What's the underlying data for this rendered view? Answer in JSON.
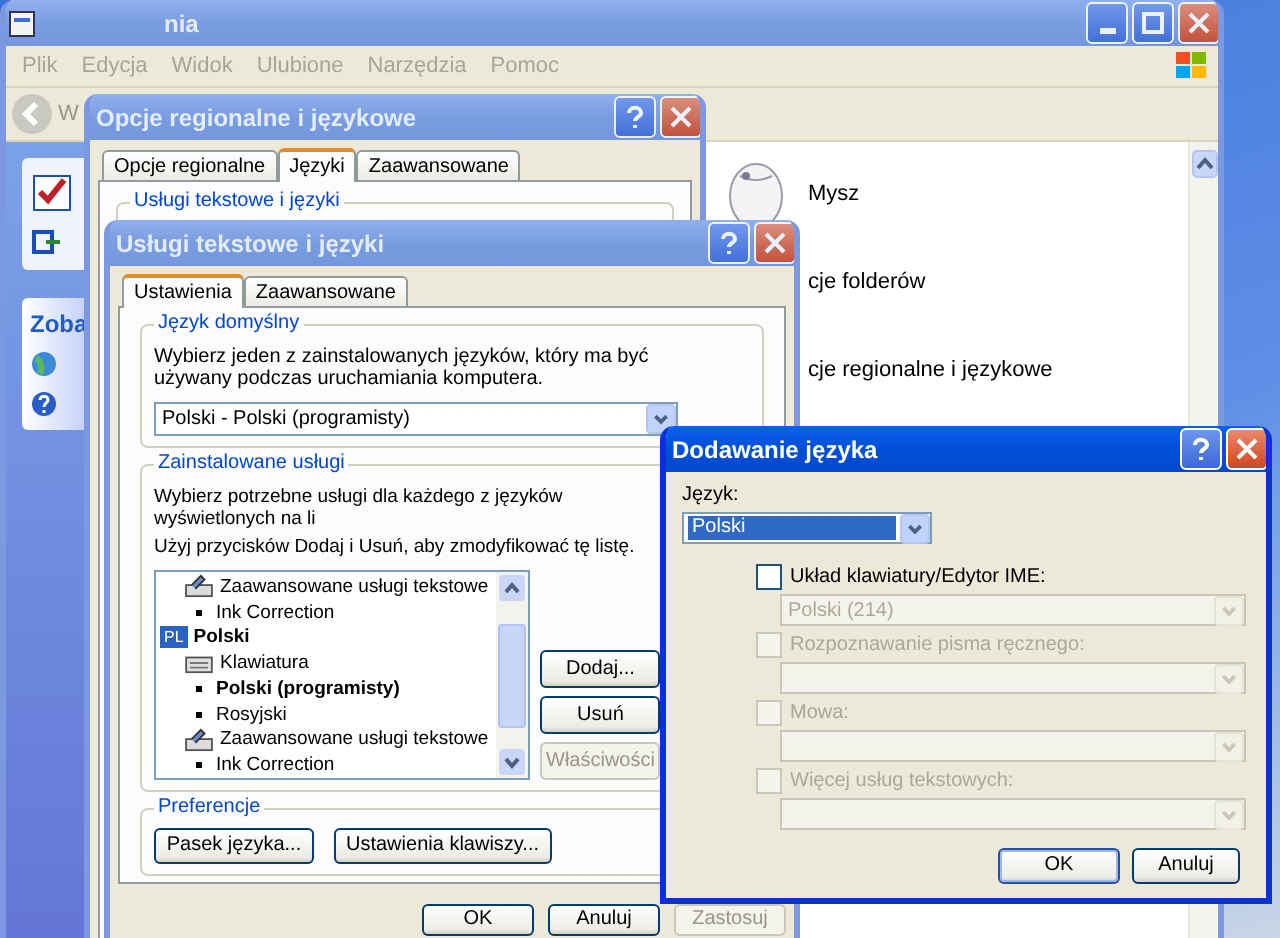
{
  "explorer": {
    "title": "nia",
    "active": false,
    "menu": [
      "Plik",
      "Edycja",
      "Widok",
      "Ulubione",
      "Narzędzia",
      "Pomoc"
    ],
    "back_label": "W",
    "task_pane_heading": "Zoba",
    "items": [
      {
        "label": "Mysz",
        "kind": "mouse"
      },
      {
        "label": "cje folderów",
        "kind": "covered"
      },
      {
        "label": "cje regionalne i językowe",
        "kind": "covered"
      }
    ]
  },
  "regional_dialog": {
    "title": "Opcje regionalne i językowe",
    "active": false,
    "tabs": [
      {
        "label": "Opcje regionalne",
        "selected": false
      },
      {
        "label": "Języki",
        "selected": true
      },
      {
        "label": "Zaawansowane",
        "selected": false
      }
    ],
    "group_title": "Usługi tekstowe i języki"
  },
  "text_services_dialog": {
    "title": "Usługi tekstowe i języki",
    "active": false,
    "tabs": [
      {
        "label": "Ustawienia",
        "selected": true
      },
      {
        "label": "Zaawansowane",
        "selected": false
      }
    ],
    "default_language": {
      "title": "Język domyślny",
      "description": "Wybierz jeden z zainstalowanych języków, który ma być używany podczas uruchamiania komputera.",
      "value": "Polski - Polski (programisty)"
    },
    "installed": {
      "title": "Zainstalowane usługi",
      "description_lines": [
        "Wybierz potrzebne usługi dla każdego z języków wyświetlonych na li",
        "Użyj przycisków Dodaj i Usuń, aby zmodyfikować tę listę."
      ],
      "tree": [
        {
          "kind": "category",
          "label": "Zaawansowane usługi tekstowe",
          "children": [
            {
              "kind": "service",
              "label": "Ink Correction",
              "default": false
            }
          ]
        },
        {
          "kind": "language",
          "badge": "PL",
          "label": "Polski",
          "children": [
            {
              "kind": "keyboard",
              "label": "Klawiatura",
              "children": [
                {
                  "kind": "service",
                  "label": "Polski (programisty)",
                  "default": true
                },
                {
                  "kind": "service",
                  "label": "Rosyjski",
                  "default": false
                }
              ]
            },
            {
              "kind": "category",
              "label": "Zaawansowane usługi tekstowe",
              "children": [
                {
                  "kind": "service",
                  "label": "Ink Correction",
                  "default": false
                }
              ]
            }
          ]
        }
      ],
      "buttons": [
        {
          "label": "Dodaj...",
          "disabled": false
        },
        {
          "label": "Usuń",
          "disabled": false
        },
        {
          "label": "Właściwości",
          "disabled": true
        }
      ]
    },
    "preferences": {
      "title": "Preferencje",
      "buttons": [
        "Pasek języka...",
        "Ustawienia klawiszy..."
      ]
    },
    "footer_buttons": [
      {
        "label": "OK",
        "disabled": false
      },
      {
        "label": "Anuluj",
        "disabled": false
      },
      {
        "label": "Zastosuj",
        "disabled": true
      }
    ]
  },
  "add_language_dialog": {
    "title": "Dodawanie języka",
    "active": true,
    "language_label": "Język:",
    "language_value": "Polski",
    "services": [
      {
        "label": "Układ klawiatury/Edytor IME:",
        "checked": false,
        "disabled": false,
        "value": "Polski (214)",
        "field_disabled": true
      },
      {
        "label": "Rozpoznawanie pisma ręcznego:",
        "checked": false,
        "disabled": true,
        "field_disabled": true
      },
      {
        "label": "Mowa:",
        "checked": false,
        "disabled": true,
        "field_disabled": true
      },
      {
        "label": "Więcej usług tekstowych:",
        "checked": false,
        "disabled": true,
        "field_disabled": true
      }
    ],
    "buttons": [
      "OK",
      "Anuluj"
    ]
  }
}
